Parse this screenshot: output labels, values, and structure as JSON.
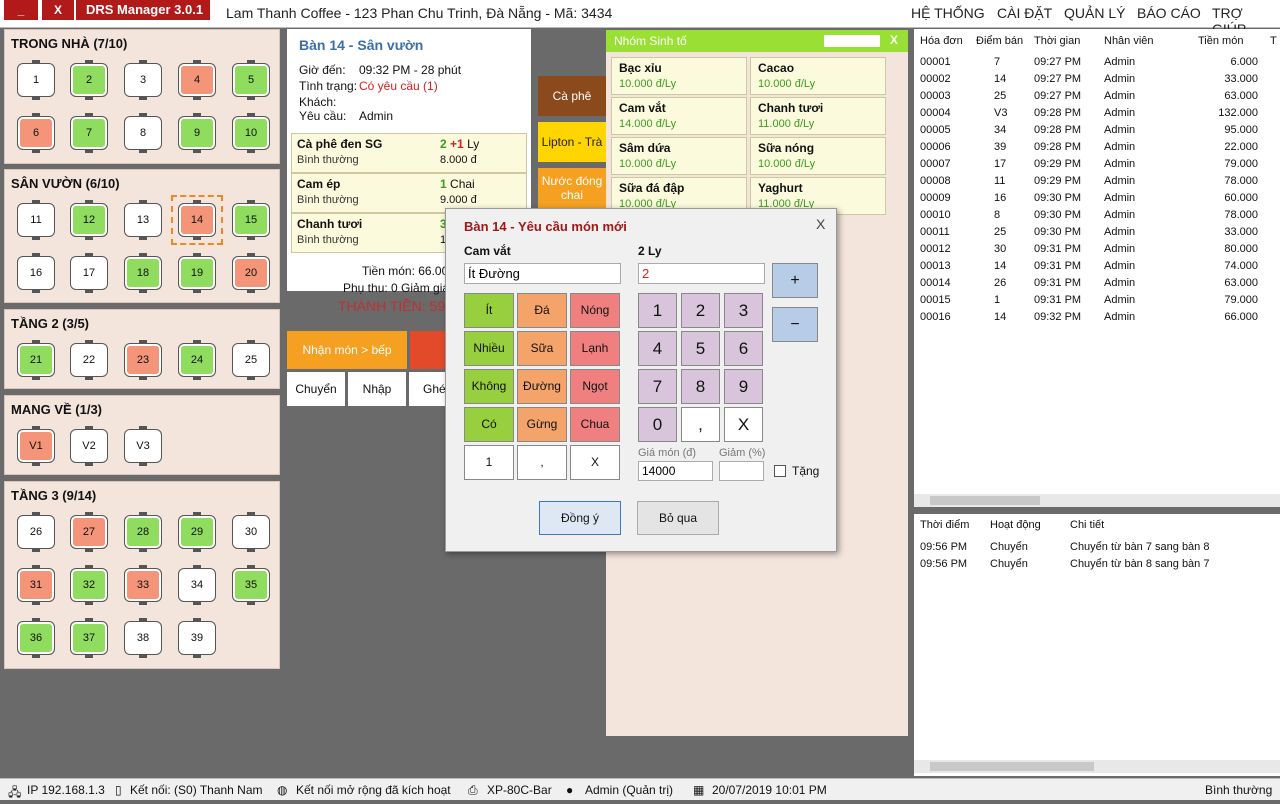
{
  "titlebar": {
    "minimize": "_",
    "close": "X",
    "app_name": "DRS Manager 3.0.1",
    "shop": "Lam Thanh Coffee  -  123 Phan Chu Trinh, Đà Nẵng  -  Mã: 3434"
  },
  "menu": [
    "HỆ THỐNG",
    "CÀI ĐẶT",
    "QUẢN LÝ",
    "BÁO CÁO",
    "TRỢ GIÚP"
  ],
  "zones": {
    "z1": {
      "title": "TRONG NHÀ  (7/10)"
    },
    "z2": {
      "title": "SÂN VƯỜN  (6/10)"
    },
    "z3": {
      "title": "TẦNG 2  (3/5)"
    },
    "z4": {
      "title": "MANG VỀ  (1/3)"
    },
    "z5": {
      "title": "TẦNG 3  (9/14)"
    }
  },
  "tables": {
    "t1": "1",
    "t2": "2",
    "t3": "3",
    "t4": "4",
    "t5": "5",
    "t6": "6",
    "t7": "7",
    "t8": "8",
    "t9": "9",
    "t10": "10",
    "t11": "11",
    "t12": "12",
    "t13": "13",
    "t14": "14",
    "t15": "15",
    "t16": "16",
    "t17": "17",
    "t18": "18",
    "t19": "19",
    "t20": "20",
    "t21": "21",
    "t22": "22",
    "t23": "23",
    "t24": "24",
    "t25": "25",
    "v1": "V1",
    "v2": "V2",
    "v3": "V3",
    "t26": "26",
    "t27": "27",
    "t28": "28",
    "t29": "29",
    "t30": "30",
    "t31": "31",
    "t32": "32",
    "t33": "33",
    "t34": "34",
    "t35": "35",
    "t36": "36",
    "t37": "37",
    "t38": "38",
    "t39": "39"
  },
  "order": {
    "title": "Bàn 14 - Sân vườn",
    "arrive_label": "Giờ đến:",
    "arrive": "09:32 PM  -  28 phút",
    "status_label": "Tình trạng:",
    "status": "Có yêu cầu (1)",
    "customer_label": "Khách:",
    "request_label": "Yêu cầu:",
    "request": "Admin",
    "items": [
      {
        "name": "Cà phê đen SG",
        "qty": "2",
        "extra": "+1",
        "unit": "Ly",
        "note": "Bình thường",
        "price": "8.000 đ"
      },
      {
        "name": "Cam ép",
        "qty": "1",
        "unit": "Chai",
        "note": "Bình thường",
        "price": "9.000 đ"
      },
      {
        "name": "Chanh tươi",
        "qty": "3",
        "note": "Bình thường",
        "price": "1"
      }
    ],
    "subtotal": "Tiền món: 66.000",
    "surcharge": "Phụ thu: 0    Giảm giá",
    "total": "THÀNH TIỀN: 59.4"
  },
  "actions": {
    "send": "Nhận món > bếp",
    "move": "Chuyển",
    "import": "Nhập",
    "merge": "Ghé"
  },
  "categories": [
    "Cà phê",
    "Lipton - Trà",
    "Nước đóng chai"
  ],
  "group": {
    "title": "Nhóm Sinh tố",
    "close": "X",
    "products": [
      {
        "name": "Bạc xỉu",
        "price": "10.000 đ/Ly"
      },
      {
        "name": "Cacao",
        "price": "10.000 đ/Ly"
      },
      {
        "name": "Cam vắt",
        "price": "14.000 đ/Ly"
      },
      {
        "name": "Chanh tươi",
        "price": "11.000 đ/Ly"
      },
      {
        "name": "Sâm dứa",
        "price": "10.000 đ/Ly"
      },
      {
        "name": "Sữa nóng",
        "price": "10.000 đ/Ly"
      },
      {
        "name": "Sữa đá đập",
        "price": "10.000 đ/Ly"
      },
      {
        "name": "Yaghurt",
        "price": "11.000 đ/Ly"
      }
    ]
  },
  "invoices": {
    "headers": [
      "Hóa đơn",
      "Điểm bán",
      "Thời gian",
      "Nhân viên",
      "Tiền món",
      "T"
    ],
    "rows": [
      [
        "00001",
        "7",
        "09:27 PM",
        "Admin",
        "6.000"
      ],
      [
        "00002",
        "14",
        "09:27 PM",
        "Admin",
        "33.000"
      ],
      [
        "00003",
        "25",
        "09:27 PM",
        "Admin",
        "63.000"
      ],
      [
        "00004",
        "V3",
        "09:28 PM",
        "Admin",
        "132.000"
      ],
      [
        "00005",
        "34",
        "09:28 PM",
        "Admin",
        "95.000"
      ],
      [
        "00006",
        "39",
        "09:28 PM",
        "Admin",
        "22.000"
      ],
      [
        "00007",
        "17",
        "09:29 PM",
        "Admin",
        "79.000"
      ],
      [
        "00008",
        "11",
        "09:29 PM",
        "Admin",
        "78.000"
      ],
      [
        "00009",
        "16",
        "09:30 PM",
        "Admin",
        "60.000"
      ],
      [
        "00010",
        "8",
        "09:30 PM",
        "Admin",
        "78.000"
      ],
      [
        "00011",
        "25",
        "09:30 PM",
        "Admin",
        "33.000"
      ],
      [
        "00012",
        "30",
        "09:31 PM",
        "Admin",
        "80.000"
      ],
      [
        "00013",
        "14",
        "09:31 PM",
        "Admin",
        "74.000"
      ],
      [
        "00014",
        "26",
        "09:31 PM",
        "Admin",
        "63.000"
      ],
      [
        "00015",
        "1",
        "09:31 PM",
        "Admin",
        "79.000"
      ],
      [
        "00016",
        "14",
        "09:32 PM",
        "Admin",
        "66.000"
      ]
    ]
  },
  "log": {
    "headers": [
      "Thời điểm",
      "Hoạt động",
      "Chi tiết"
    ],
    "rows": [
      [
        "09:56 PM",
        "Chuyển",
        "Chuyển từ bàn 7 sang bàn 8"
      ],
      [
        "09:56 PM",
        "Chuyển",
        "Chuyển từ bàn 8 sang bàn 7"
      ]
    ]
  },
  "dialog": {
    "title": "Bàn 14 - Yêu cầu món mới",
    "close": "X",
    "item": "Cam vắt",
    "qty_label": "2 Ly",
    "note_value": "Ít Đường",
    "qty_value": "2",
    "options": [
      "Ít",
      "Đá",
      "Nóng",
      "Nhiều",
      "Sữa",
      "Lạnh",
      "Không",
      "Đường",
      "Ngọt",
      "Có",
      "Gừng",
      "Chua",
      "1",
      ",",
      "X"
    ],
    "plus": "+",
    "minus": "−",
    "keys": [
      "1",
      "2",
      "3",
      "4",
      "5",
      "6",
      "7",
      "8",
      "9",
      "0",
      ",",
      "X"
    ],
    "price_label": "Giá món (đ)",
    "price_value": "14000",
    "discount_label": "Giảm (%)",
    "gift_label": "Tặng",
    "ok": "Đồng ý",
    "skip": "Bỏ qua"
  },
  "statusbar": {
    "ip": "IP 192.168.1.3",
    "conn": "Kết nối: (S0) Thanh Nam",
    "ext": "Kết nối mở rộng đã kích hoạt",
    "printer": "XP-80C-Bar",
    "user": "Admin (Quản trị)",
    "datetime": "20/07/2019 10:01 PM",
    "mode": "Bình thường"
  },
  "colors": {
    "accent_red": "#b21a1a",
    "free": "#ffffff",
    "occupied": "#8fdc5e",
    "requested": "#f4957a",
    "orange": "#f5a020"
  }
}
